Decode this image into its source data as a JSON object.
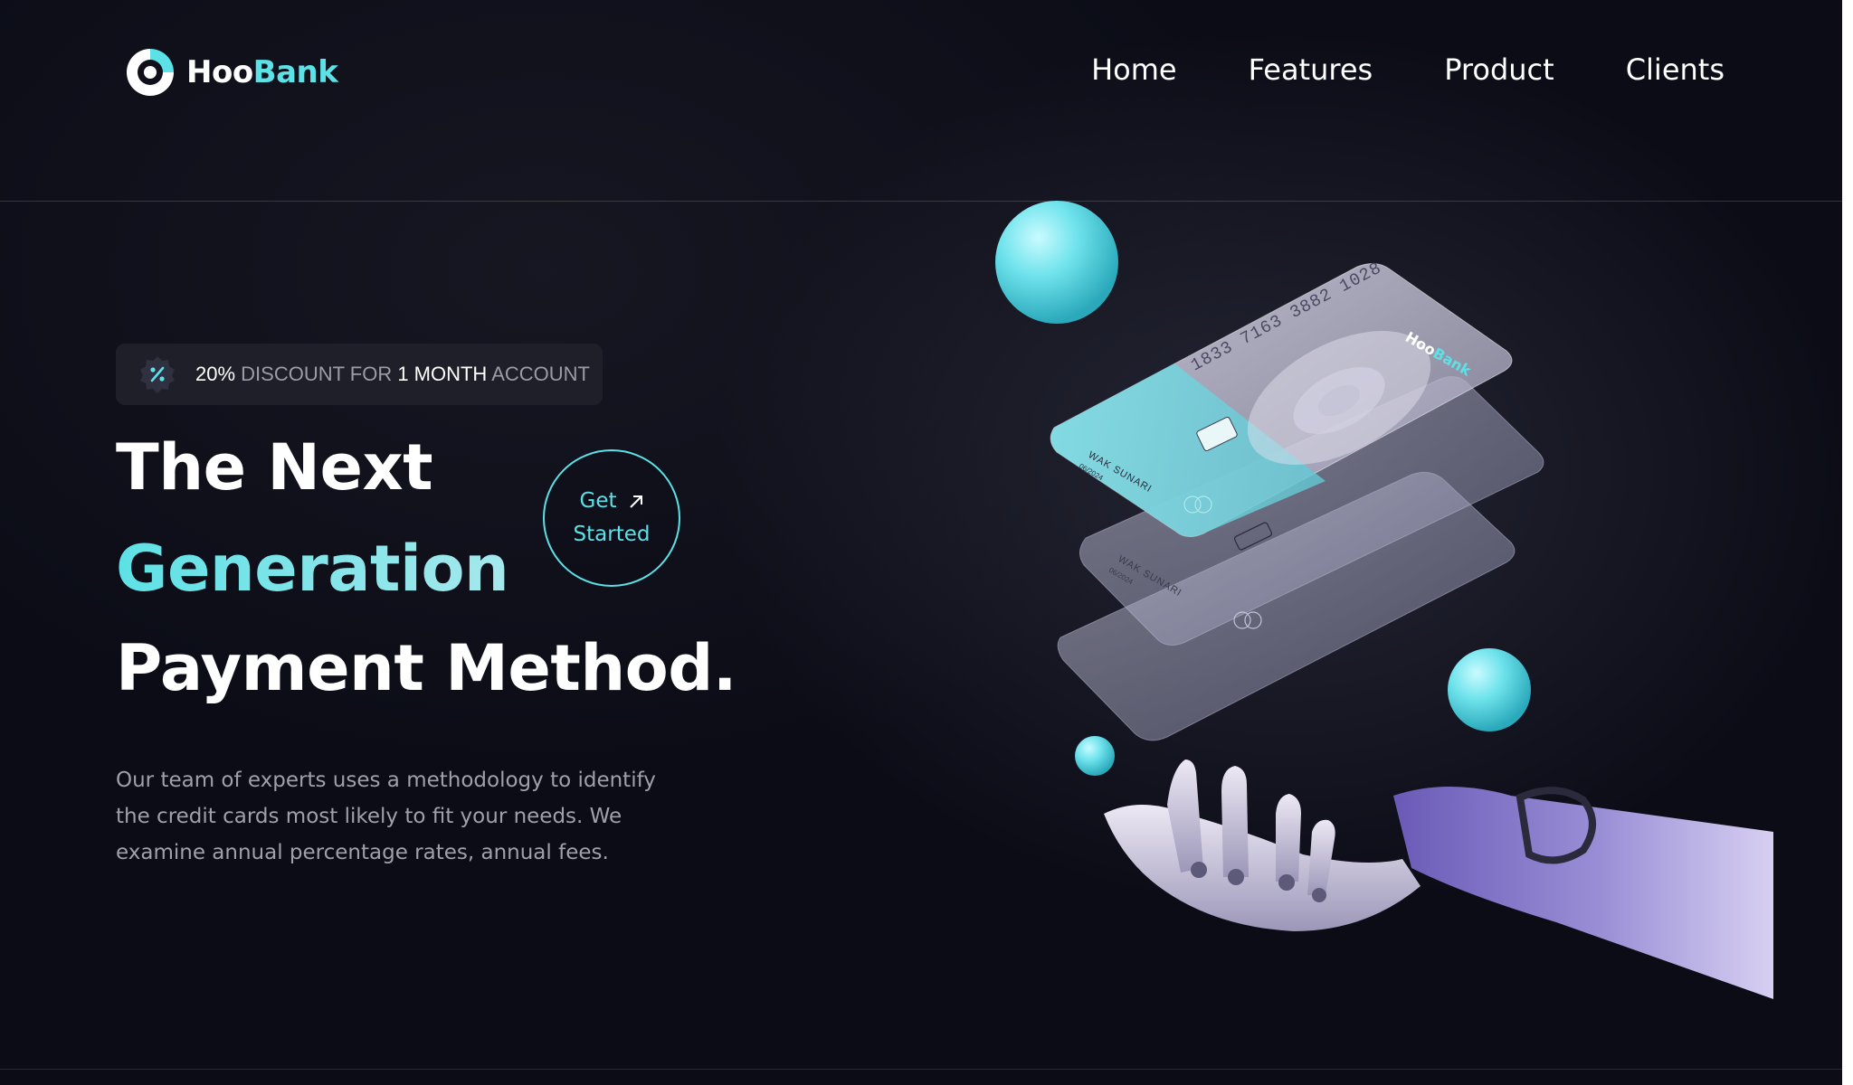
{
  "brand": {
    "name_part1": "Hoo",
    "name_part2": "Bank",
    "accent_color": "#5ce1e6"
  },
  "nav": {
    "links": [
      "Home",
      "Features",
      "Product",
      "Clients"
    ]
  },
  "badge": {
    "icon": "discount-icon",
    "percent": "20%",
    "text1": " DISCOUNT FOR ",
    "highlight": "1 MONTH",
    "text2": " ACCOUNT"
  },
  "hero": {
    "line1": "The Next",
    "line2": "Generation",
    "line3": "Payment Method.",
    "cta_line1": "Get",
    "cta_line2": "Started",
    "cta_icon": "arrow-up-right-icon",
    "description": "Our team of experts uses a methodology to identify the credit cards most likely to fit your needs. We examine annual percentage rates, annual fees."
  },
  "card": {
    "number": "1833 7163 3882 1028",
    "holder": "WAK SUNARI",
    "expiry": "06/2024",
    "brand_part1": "Hoo",
    "brand_part2": "Bank"
  }
}
